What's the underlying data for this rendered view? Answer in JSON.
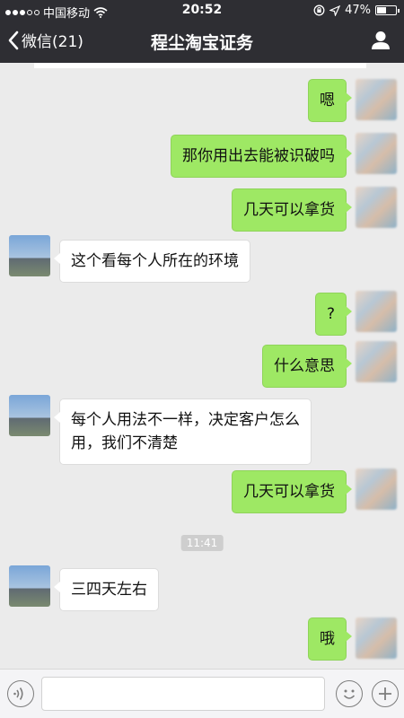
{
  "status_bar": {
    "carrier": "中国移动",
    "time": "20:52",
    "battery": "47%",
    "battery_level": 0.47,
    "icons": [
      "signal-dots",
      "wifi-icon",
      "rotation-lock-icon",
      "location-arrow-icon",
      "battery-icon"
    ]
  },
  "nav": {
    "back_label": "微信(21)",
    "title": "程尘淘宝证务",
    "icons": [
      "back-chevron-icon",
      "user-profile-icon"
    ]
  },
  "messages": [
    {
      "side": "self",
      "text": "嗯"
    },
    {
      "side": "self",
      "text": "那你用出去能被识破吗"
    },
    {
      "side": "self",
      "text": "几天可以拿货"
    },
    {
      "side": "other",
      "text": "这个看每个人所在的环境"
    },
    {
      "side": "self",
      "text": "?"
    },
    {
      "side": "self",
      "text": "什么意思"
    },
    {
      "side": "other",
      "text": "每个人用法不一样，决定客户怎么\n用，我们不清楚"
    },
    {
      "side": "self",
      "text": "几天可以拿货"
    },
    {
      "type": "time",
      "text": "11:41"
    },
    {
      "side": "other",
      "text": "三四天左右"
    },
    {
      "side": "self",
      "text": "哦"
    }
  ],
  "input_bar": {
    "icons": [
      "voice-icon",
      "emoji-icon",
      "plus-icon"
    ],
    "text_value": ""
  },
  "colors": {
    "header_bg": "#2e2e33",
    "self_bubble": "#9ee864",
    "other_bubble": "#ffffff",
    "chat_bg": "#ebebeb"
  }
}
